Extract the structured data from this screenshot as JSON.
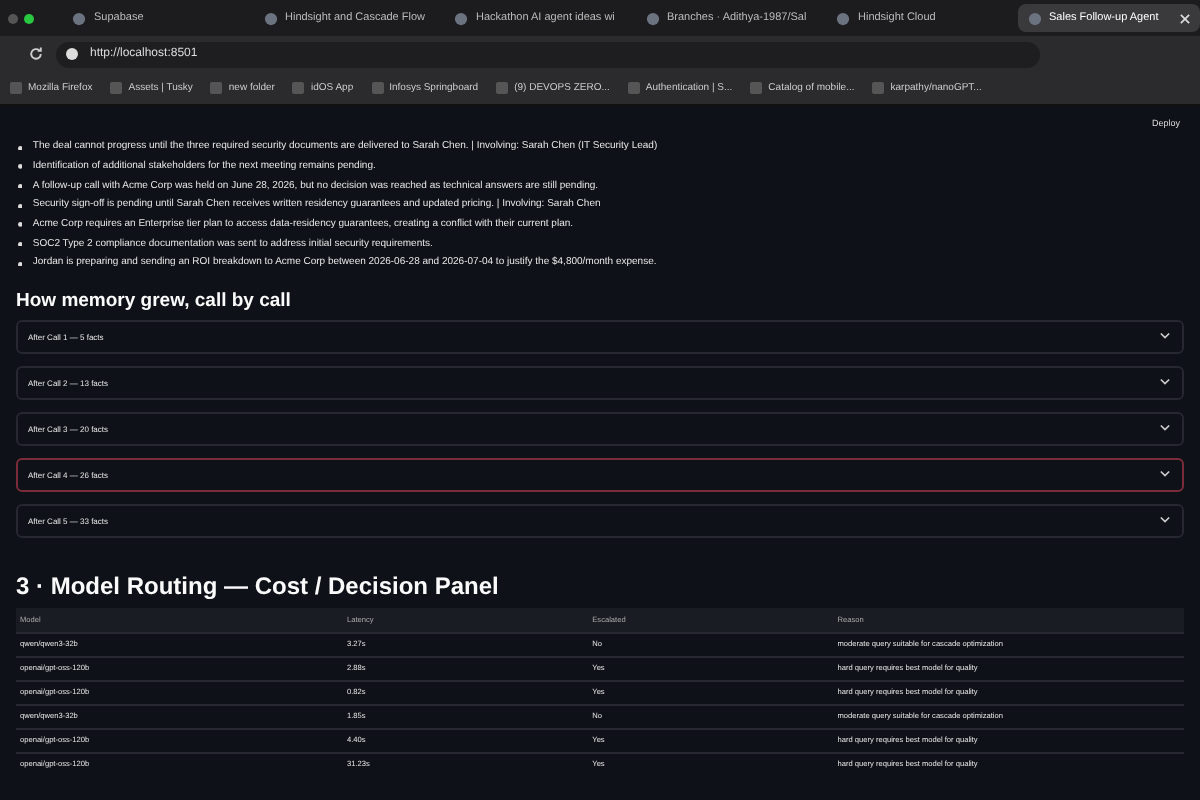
{
  "tabs": [
    {
      "label": "Supabase",
      "selected": false
    },
    {
      "label": "Hindsight and Cascade Flow",
      "selected": false
    },
    {
      "label": "Hackathon AI agent ideas wi",
      "selected": false
    },
    {
      "label": "Branches · Adithya-1987/Sal",
      "selected": false
    },
    {
      "label": "Hindsight Cloud",
      "selected": false
    },
    {
      "label": "Sales Follow-up Agent",
      "selected": true
    }
  ],
  "address_bar": {
    "url": "http://localhost:8501"
  },
  "bookmarks": [
    "Mozilla Firefox",
    "Assets | Tusky",
    "new folder",
    "idOS App",
    "Infosys Springboard",
    "(9) DEVOPS ZERO...",
    "Authentication | S...",
    "Catalog of mobile...",
    "karpathy/nanoGPT..."
  ],
  "deploy_button": "Deploy",
  "facts": [
    "The deal cannot progress until the three required security documents are delivered to Sarah Chen. | Involving: Sarah Chen (IT Security Lead)",
    "Identification of additional stakeholders for the next meeting remains pending.",
    "A follow-up call with Acme Corp was held on June 28, 2026, but no decision was reached as technical answers are still pending.",
    "Security sign-off is pending until Sarah Chen receives written residency guarantees and updated pricing. | Involving: Sarah Chen",
    "Acme Corp requires an Enterprise tier plan to access data-residency guarantees, creating a conflict with their current plan.",
    "SOC2 Type 2 compliance documentation was sent to address initial security requirements.",
    "Jordan is preparing and sending an ROI breakdown to Acme Corp between 2026-06-28 and 2026-07-04 to justify the $4,800/month expense."
  ],
  "memory_heading": "How memory grew, call by call",
  "expanders": [
    {
      "label": "After Call 1 — 5 facts",
      "hovered": false
    },
    {
      "label": "After Call 2 — 13 facts",
      "hovered": false
    },
    {
      "label": "After Call 3 — 20 facts",
      "hovered": false
    },
    {
      "label": "After Call 4 — 26 facts",
      "hovered": true
    },
    {
      "label": "After Call 5 — 33 facts",
      "hovered": false
    }
  ],
  "routing_heading": "3 · Model Routing — Cost / Decision Panel",
  "table": {
    "columns": [
      "Model",
      "Latency",
      "Escalated",
      "Reason"
    ],
    "rows": [
      [
        "qwen/qwen3-32b",
        "3.27s",
        "No",
        "moderate query suitable for cascade optimization"
      ],
      [
        "openai/gpt-oss-120b",
        "2.88s",
        "Yes",
        "hard query requires best model for quality"
      ],
      [
        "openai/gpt-oss-120b",
        "0.82s",
        "Yes",
        "hard query requires best model for quality"
      ],
      [
        "qwen/qwen3-32b",
        "1.85s",
        "No",
        "moderate query suitable for cascade optimization"
      ],
      [
        "openai/gpt-oss-120b",
        "4.40s",
        "Yes",
        "hard query requires best model for quality"
      ],
      [
        "openai/gpt-oss-120b",
        "31.23s",
        "Yes",
        "hard query requires best model for quality"
      ]
    ]
  }
}
